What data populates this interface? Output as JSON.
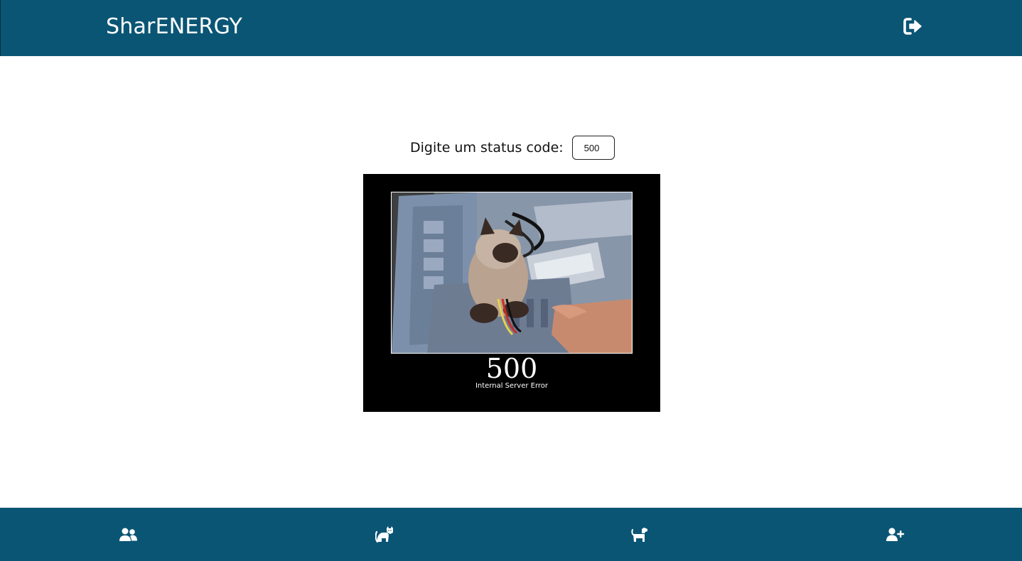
{
  "header": {
    "brand": "SharENERGY",
    "logout_icon": "sign-out-icon"
  },
  "main": {
    "status_label": "Digite um status code:",
    "status_input_value": "500",
    "image": {
      "code": "500",
      "description": "Internal Server Error"
    }
  },
  "footer": {
    "nav": [
      {
        "icon": "users-icon"
      },
      {
        "icon": "cat-icon"
      },
      {
        "icon": "dog-icon"
      },
      {
        "icon": "user-plus-icon"
      }
    ]
  },
  "colors": {
    "primary": "#0a5574",
    "background": "#ffffff"
  }
}
